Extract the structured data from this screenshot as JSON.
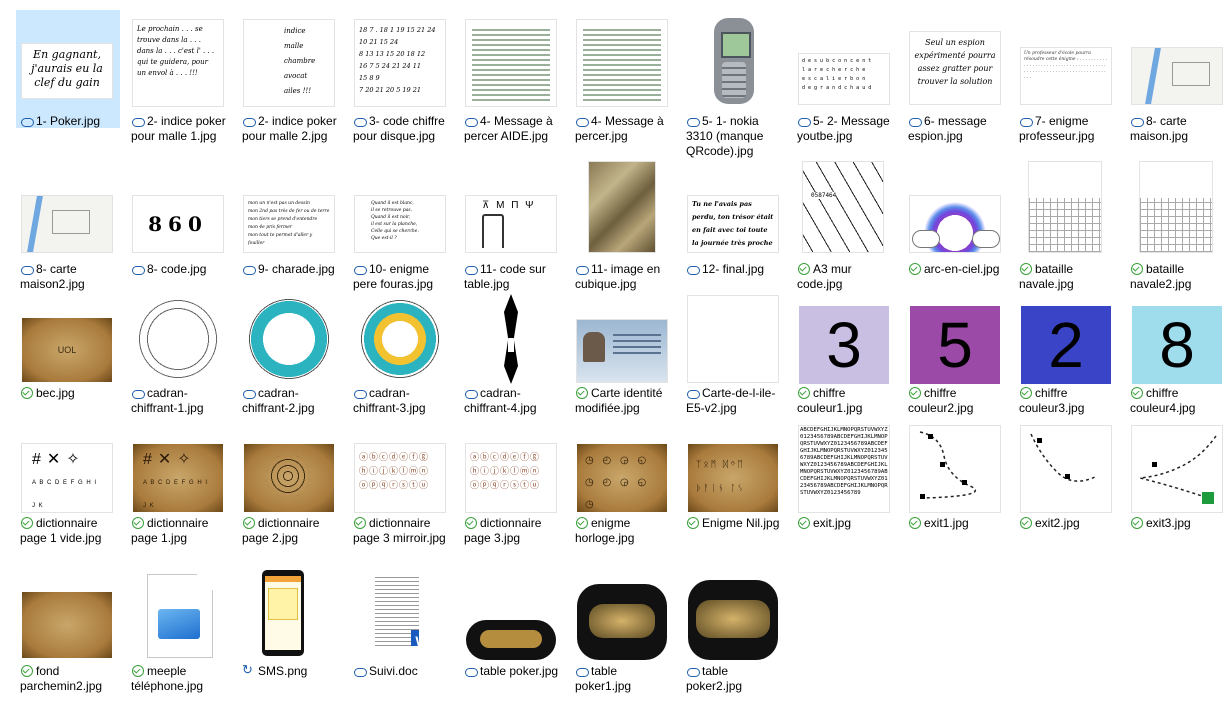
{
  "files": [
    {
      "label": "1- Poker.jpg",
      "status": "cloud"
    },
    {
      "label": "2- indice poker pour malle 1.jpg",
      "status": "cloud"
    },
    {
      "label": "2- indice poker pour malle 2.jpg",
      "status": "cloud"
    },
    {
      "label": "3- code chiffre pour disque.jpg",
      "status": "cloud"
    },
    {
      "label": "4- Message à percer AIDE.jpg",
      "status": "cloud"
    },
    {
      "label": "4- Message à percer.jpg",
      "status": "cloud"
    },
    {
      "label": "5- 1- nokia 3310 (manque QRcode).jpg",
      "status": "cloud"
    },
    {
      "label": "5- 2- Message youtbe.jpg",
      "status": "cloud"
    },
    {
      "label": "6- message espion.jpg",
      "status": "cloud"
    },
    {
      "label": "7- enigme professeur.jpg",
      "status": "cloud"
    },
    {
      "label": "8- carte maison.jpg",
      "status": "cloud"
    },
    {
      "label": "8- carte maison2.jpg",
      "status": "cloud"
    },
    {
      "label": "8- code.jpg",
      "status": "cloud"
    },
    {
      "label": "9- charade.jpg",
      "status": "cloud"
    },
    {
      "label": "10- enigme pere fouras.jpg",
      "status": "cloud"
    },
    {
      "label": "11- code sur table.jpg",
      "status": "cloud"
    },
    {
      "label": "11- image en cubique.jpg",
      "status": "cloud"
    },
    {
      "label": "12- final.jpg",
      "status": "cloud"
    },
    {
      "label": "A3 mur code.jpg",
      "status": "check"
    },
    {
      "label": "arc-en-ciel.jpg",
      "status": "check"
    },
    {
      "label": "bataille navale.jpg",
      "status": "check"
    },
    {
      "label": "bataille navale2.jpg",
      "status": "check"
    },
    {
      "label": "bec.jpg",
      "status": "check"
    },
    {
      "label": "cadran-chiffrant-1.jpg",
      "status": "cloud"
    },
    {
      "label": "cadran-chiffrant-2.jpg",
      "status": "cloud"
    },
    {
      "label": "cadran-chiffrant-3.jpg",
      "status": "cloud"
    },
    {
      "label": "cadran-chiffrant-4.jpg",
      "status": "cloud"
    },
    {
      "label": "Carte identité modifiée.jpg",
      "status": "check"
    },
    {
      "label": "Carte-de-l-ile-E5-v2.jpg",
      "status": "cloud"
    },
    {
      "label": "chiffre couleur1.jpg",
      "status": "check"
    },
    {
      "label": "chiffre couleur2.jpg",
      "status": "check"
    },
    {
      "label": "chiffre couleur3.jpg",
      "status": "check"
    },
    {
      "label": "chiffre couleur4.jpg",
      "status": "check"
    },
    {
      "label": "dictionnaire page 1 vide.jpg",
      "status": "check"
    },
    {
      "label": "dictionnaire page 1.jpg",
      "status": "check"
    },
    {
      "label": "dictionnaire page 2.jpg",
      "status": "check"
    },
    {
      "label": "dictionnaire page 3 mirroir.jpg",
      "status": "check"
    },
    {
      "label": "dictionnaire page 3.jpg",
      "status": "check"
    },
    {
      "label": "enigme horloge.jpg",
      "status": "check"
    },
    {
      "label": "Enigme Nil.jpg",
      "status": "check"
    },
    {
      "label": "exit.jpg",
      "status": "check"
    },
    {
      "label": "exit1.jpg",
      "status": "check"
    },
    {
      "label": "exit2.jpg",
      "status": "check"
    },
    {
      "label": "exit3.jpg",
      "status": "check"
    },
    {
      "label": "fond parchemin2.jpg",
      "status": "check"
    },
    {
      "label": "meeple téléphone.jpg",
      "status": "check"
    },
    {
      "label": "SMS.png",
      "status": "sync"
    },
    {
      "label": "Suivi.doc",
      "status": "cloud"
    },
    {
      "label": "table poker.jpg",
      "status": "cloud"
    },
    {
      "label": "table poker1.jpg",
      "status": "cloud"
    },
    {
      "label": "table poker2.jpg",
      "status": "cloud"
    }
  ],
  "thumb_text": {
    "poker": "En gagnant, j'aurais eu la clef du gain",
    "code860": "860",
    "chiffre1": "3",
    "chiffre2": "5",
    "chiffre3": "2",
    "chiffre4": "8",
    "final": "Tu ne l'avais pas perdu, ton trésor était en fait avec toi toute la journée très proche de tes hanches",
    "espion": "Seul un espion expérimenté pourra assez gratter pour trouver la solution",
    "bec": "UOL"
  },
  "colors": {
    "chiffre1": "#c9bfe3",
    "chiffre2": "#9c4aa8",
    "chiffre3": "#3a44c6",
    "chiffre4": "#9fdcec",
    "selected": "#cce8ff"
  }
}
